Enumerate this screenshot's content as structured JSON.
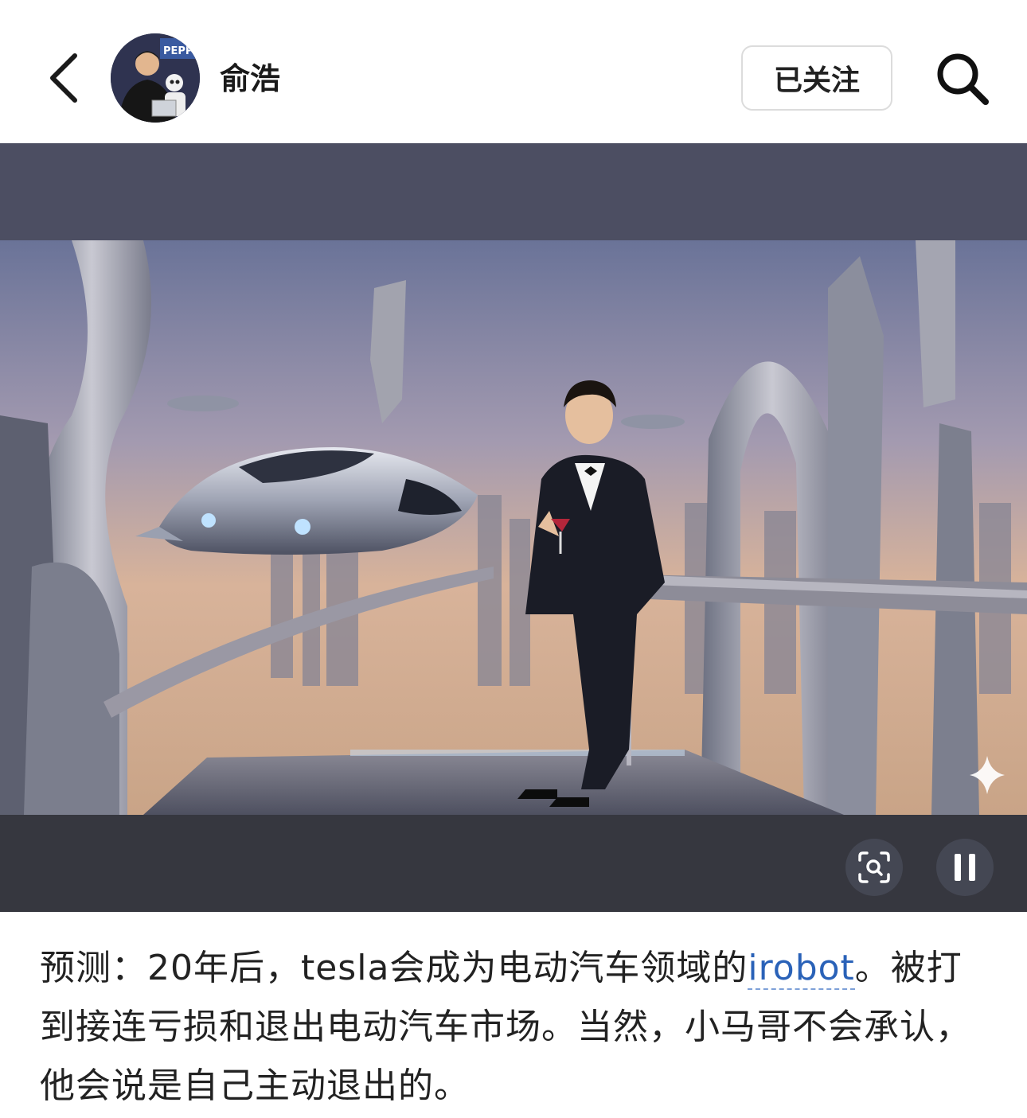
{
  "header": {
    "back_icon": "chevron-left-icon",
    "username": "俞浩",
    "follow_label": "已关注",
    "search_icon": "search-icon"
  },
  "avatar": {
    "image_text": "PEPP"
  },
  "media": {
    "lens_icon": "visual-search-icon",
    "pause_icon": "pause-icon",
    "sparkle_icon": "sparkle-icon"
  },
  "post": {
    "text_before_link": "预测：20年后，tesla会成为电动汽车领域的",
    "link_text": "irobot",
    "text_after_link": "。被打到接连亏损和退出电动汽车市场。当然，小马哥不会承认，他会说是自己主动退出的。"
  },
  "colors": {
    "link": "#2a62b8",
    "media_bg": "#3d3f50",
    "text": "#222222"
  }
}
